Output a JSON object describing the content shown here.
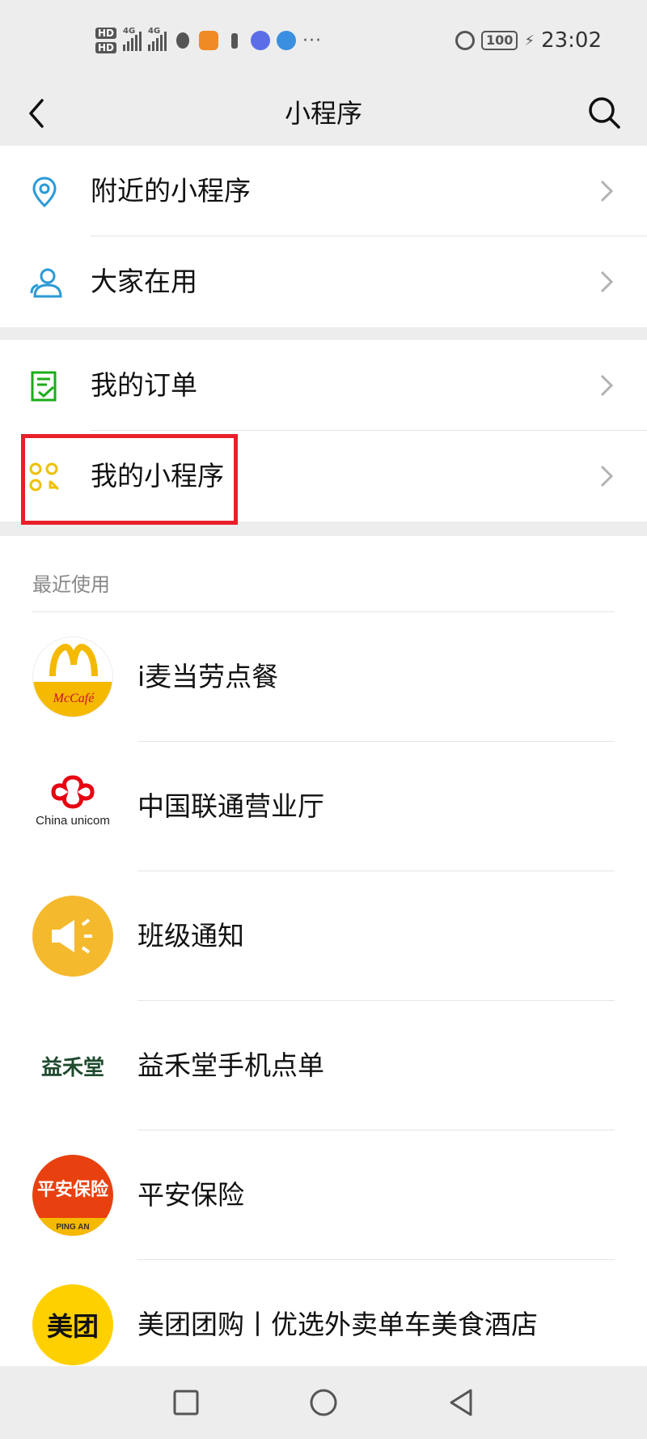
{
  "status_bar": {
    "hd1": "HD",
    "hd2": "HD",
    "net1": "4G",
    "net2": "4G",
    "more": "···",
    "battery": "100",
    "time": "23:02"
  },
  "nav": {
    "title": "小程序",
    "back_icon": "chevron-left-icon",
    "search_icon": "search-icon"
  },
  "group1": [
    {
      "label": "附近的小程序",
      "icon": "location-pin-icon",
      "color": "#2b9ad6"
    },
    {
      "label": "大家在用",
      "icon": "users-icon",
      "color": "#2b9ad6"
    }
  ],
  "group2": [
    {
      "label": "我的订单",
      "icon": "order-check-icon",
      "color": "#1aad19"
    },
    {
      "label": "我的小程序",
      "icon": "my-miniprogram-icon",
      "color": "#f0c000"
    }
  ],
  "recent": {
    "header": "最近使用",
    "apps": [
      {
        "name": "i麦当劳点餐",
        "logo_text": "McCafé"
      },
      {
        "name": "中国联通营业厅",
        "logo_text": "China unicom"
      },
      {
        "name": "班级通知",
        "logo_text": ""
      },
      {
        "name": "益禾堂手机点单",
        "logo_text": "益禾堂"
      },
      {
        "name": "平安保险",
        "logo_text": "平安保险",
        "logo_sub": "PING AN"
      },
      {
        "name": "美团团购丨优选外卖单车美食酒店",
        "logo_text": "美团"
      }
    ]
  },
  "colors": {
    "highlight": "#e8202a",
    "background": "#ededed"
  }
}
